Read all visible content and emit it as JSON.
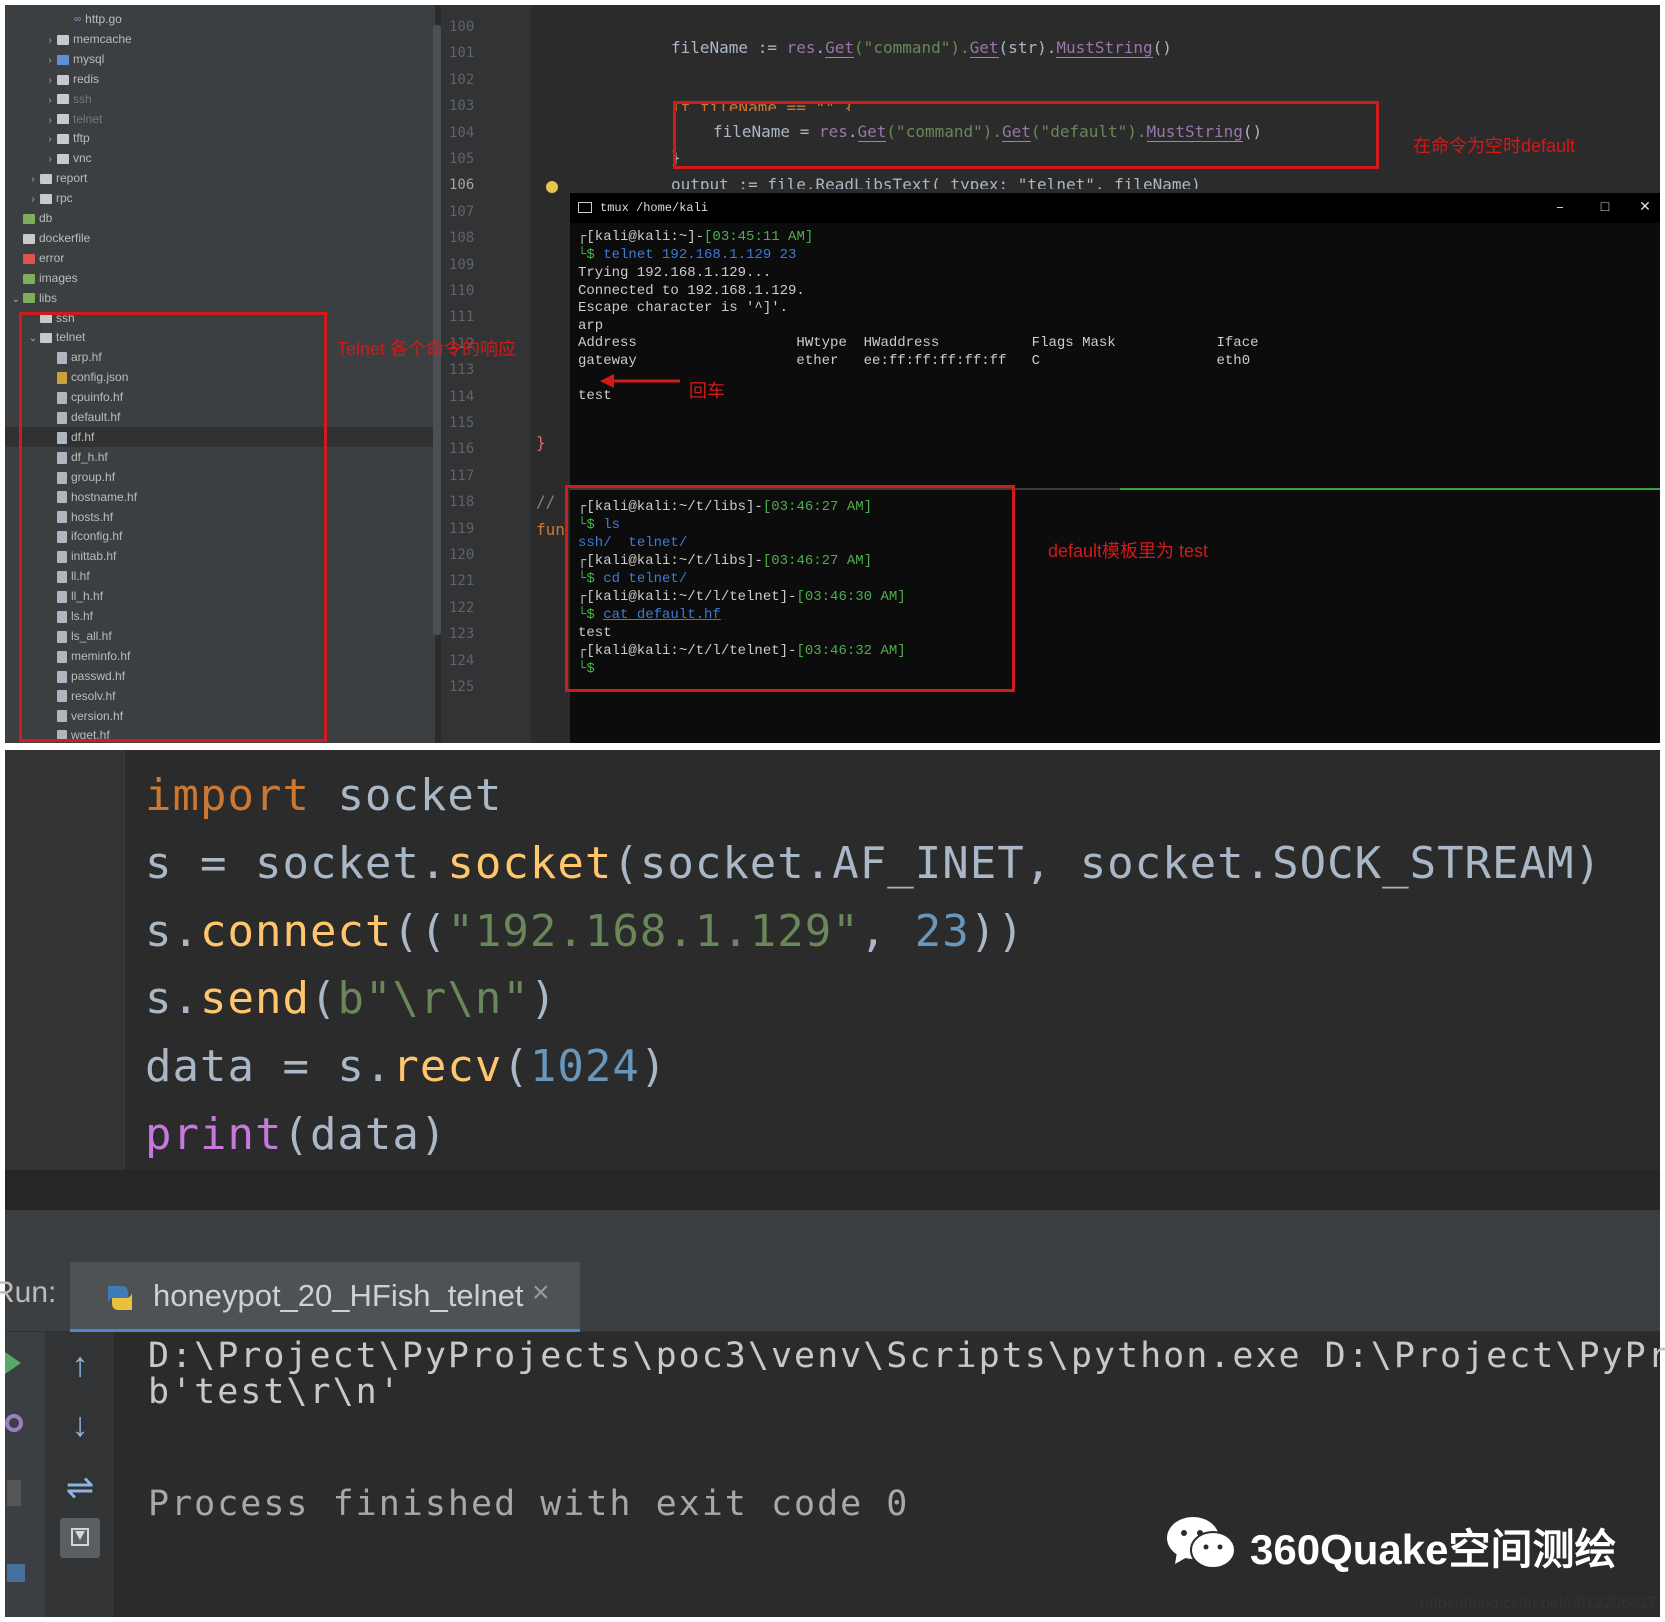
{
  "file_tree": [
    {
      "label": "http.go",
      "icon": "link-icon",
      "chev": "",
      "indent": 3
    },
    {
      "label": "memcache",
      "icon": "folder-icon",
      "chev": "›",
      "indent": 2
    },
    {
      "label": "mysql",
      "icon": "folder-blue-icon",
      "chev": "›",
      "indent": 2
    },
    {
      "label": "redis",
      "icon": "folder-outline-icon",
      "chev": "›",
      "indent": 2
    },
    {
      "label": "ssh",
      "icon": "folder-outline-icon",
      "chev": "›",
      "indent": 2
    },
    {
      "label": "telnet",
      "icon": "folder-outline-icon",
      "chev": "›",
      "indent": 2
    },
    {
      "label": "tftp",
      "icon": "folder-icon",
      "chev": "›",
      "indent": 2
    },
    {
      "label": "vnc",
      "icon": "folder-icon",
      "chev": "›",
      "indent": 2
    },
    {
      "label": "report",
      "icon": "folder-icon",
      "chev": "›",
      "indent": 1
    },
    {
      "label": "rpc",
      "icon": "folder-icon",
      "chev": "›",
      "indent": 1
    },
    {
      "label": "db",
      "icon": "folder-green-icon",
      "chev": "",
      "indent": 0
    },
    {
      "label": "dockerfile",
      "icon": "folder-icon",
      "chev": "",
      "indent": 0
    },
    {
      "label": "error",
      "icon": "folder-red-icon",
      "chev": "",
      "indent": 0
    },
    {
      "label": "images",
      "icon": "folder-green-icon",
      "chev": "",
      "indent": 0
    },
    {
      "label": "libs",
      "icon": "folder-green-icon",
      "chev": "⌄",
      "indent": 0
    },
    {
      "label": "ssh",
      "icon": "folder-icon",
      "chev": "",
      "indent": 1
    },
    {
      "label": "telnet",
      "icon": "folder-icon",
      "chev": "⌄",
      "indent": 1
    },
    {
      "label": "arp.hf",
      "icon": "file-icon",
      "chev": "",
      "indent": 2
    },
    {
      "label": "config.json",
      "icon": "json-file-icon",
      "chev": "",
      "indent": 2
    },
    {
      "label": "cpuinfo.hf",
      "icon": "file-icon",
      "chev": "",
      "indent": 2
    },
    {
      "label": "default.hf",
      "icon": "file-icon",
      "chev": "",
      "indent": 2
    },
    {
      "label": "df.hf",
      "icon": "file-icon",
      "chev": "",
      "indent": 2
    },
    {
      "label": "df_h.hf",
      "icon": "file-icon",
      "chev": "",
      "indent": 2
    },
    {
      "label": "group.hf",
      "icon": "file-icon",
      "chev": "",
      "indent": 2
    },
    {
      "label": "hostname.hf",
      "icon": "file-icon",
      "chev": "",
      "indent": 2
    },
    {
      "label": "hosts.hf",
      "icon": "file-icon",
      "chev": "",
      "indent": 2
    },
    {
      "label": "ifconfig.hf",
      "icon": "file-icon",
      "chev": "",
      "indent": 2
    },
    {
      "label": "inittab.hf",
      "icon": "file-icon",
      "chev": "",
      "indent": 2
    },
    {
      "label": "ll.hf",
      "icon": "file-icon",
      "chev": "",
      "indent": 2
    },
    {
      "label": "ll_h.hf",
      "icon": "file-icon",
      "chev": "",
      "indent": 2
    },
    {
      "label": "ls.hf",
      "icon": "file-icon",
      "chev": "",
      "indent": 2
    },
    {
      "label": "ls_all.hf",
      "icon": "file-icon",
      "chev": "",
      "indent": 2
    },
    {
      "label": "meminfo.hf",
      "icon": "file-icon",
      "chev": "",
      "indent": 2
    },
    {
      "label": "passwd.hf",
      "icon": "file-icon",
      "chev": "",
      "indent": 2
    },
    {
      "label": "resolv.hf",
      "icon": "file-icon",
      "chev": "",
      "indent": 2
    },
    {
      "label": "version.hf",
      "icon": "file-icon",
      "chev": "",
      "indent": 2
    },
    {
      "label": "wget.hf",
      "icon": "file-icon",
      "chev": "",
      "indent": 2
    }
  ],
  "line_numbers": [
    "100",
    "101",
    "102",
    "103",
    "104",
    "105",
    "106",
    "107",
    "108",
    "109",
    "110",
    "111",
    "112",
    "113",
    "114",
    "115",
    "116",
    "117",
    "118",
    "119",
    "120",
    "121",
    "122",
    "123",
    "124",
    "125"
  ],
  "editor_code": {
    "l101_a": "fileName := ",
    "l101_b": "res",
    "l101_c": ".",
    "l101_d": "Get",
    "l101_e": "(\"command\").",
    "l101_f": "Get",
    "l101_g": "(str).",
    "l101_h": "MustString",
    "l101_i": "()",
    "l103": "if fileName == \"\" {",
    "l104_a": "fileName = ",
    "l104_b": "res",
    "l104_c": ".",
    "l104_d": "Get",
    "l104_e": "(\"command\").",
    "l104_f": "Get",
    "l104_g": "(\"default\").",
    "l104_h": "MustString",
    "l104_i": "()",
    "l105": "}",
    "l106": "output := file.ReadLibsText( typex: \"telnet\", fileName)",
    "l115": "}",
    "l117": "//",
    "l118": "fun"
  },
  "tmux": {
    "title": "tmux /home/kali",
    "minimize": "–",
    "maximize": "□",
    "close": "✕",
    "lines_top": [
      {
        "prompt": "┌[kali@kali:~]-",
        "time": "[03:45:11 AM]"
      },
      {
        "cmd_prefix": "└$ ",
        "cmd": "telnet 192.168.1.129 23"
      }
    ],
    "out_top": [
      "Trying 192.168.1.129...",
      "Connected to 192.168.1.129.",
      "Escape character is '^]'.",
      "arp",
      "Address                   HWtype  HWaddress           Flags Mask            Iface",
      "gateway                   ether   ee:ff:ff:ff:ff:ff   C                     eth0",
      "",
      "test"
    ],
    "bottom": {
      "p1": "┌[kali@kali:~/t/libs]-",
      "t1": "[03:46:27 AM]",
      "c1_prefix": "└$ ",
      "c1": "ls",
      "ls_a": "ssh/",
      "ls_b": "telnet/",
      "p2": "┌[kali@kali:~/t/libs]-",
      "t2": "[03:46:27 AM]",
      "c2_prefix": "└$ ",
      "c2": "cd telnet/",
      "p3": "┌[kali@kali:~/t/l/telnet]-",
      "t3": "[03:46:30 AM]",
      "c3_prefix": "└$ ",
      "c3": "cat default.hf",
      "out3": "test",
      "p4": "┌[kali@kali:~/t/l/telnet]-",
      "t4": "[03:46:32 AM]",
      "c4_prefix": "└$"
    }
  },
  "annotations": {
    "default_empty": "在命令为空时default",
    "telnet_response": "Telnet 各个命令的响应",
    "enter": "回车",
    "default_template": "default模板里为 test"
  },
  "python_code": {
    "l1_kw": "import",
    "l1_rest": " socket",
    "l2_a": "s = socket.",
    "l2_fn": "socket",
    "l2_b": "(socket.AF_INET, socket.SOCK_STREAM)",
    "l3_a": "s.",
    "l3_fn": "connect",
    "l3_b": "((",
    "l3_str": "\"192.168.1.129\"",
    "l3_c": ", ",
    "l3_num": "23",
    "l3_d": "))",
    "l4_a": "s.",
    "l4_fn": "send",
    "l4_b": "(",
    "l4_str": "b\"\\r\\n\"",
    "l4_c": ")",
    "l5_a": "data = s.",
    "l5_fn": "recv",
    "l5_b": "(",
    "l5_num": "1024",
    "l5_c": ")",
    "l6_bi": "print",
    "l6_b": "(data)"
  },
  "run": {
    "label": "Run:",
    "tab_label": "honeypot_20_HFish_telnet",
    "tab_close": "×",
    "out1": "D:\\Project\\PyProjects\\poc3\\venv\\Scripts\\python.exe D:\\Project\\PyProj",
    "out2": "b'test\\r\\n'",
    "out3": "Process finished with exit code 0",
    "tools": [
      "arrow-up-icon",
      "arrow-down-icon",
      "soft-wrap-icon",
      "scroll-to-end-icon"
    ]
  },
  "watermark": "360Quake空间测绘",
  "url": "https://blog.csdn.net/u012206617",
  "colors": {
    "accent": "#d11a1a",
    "ide_bg": "#2b2b2b",
    "terminal_bg": "#0c0c0c"
  }
}
